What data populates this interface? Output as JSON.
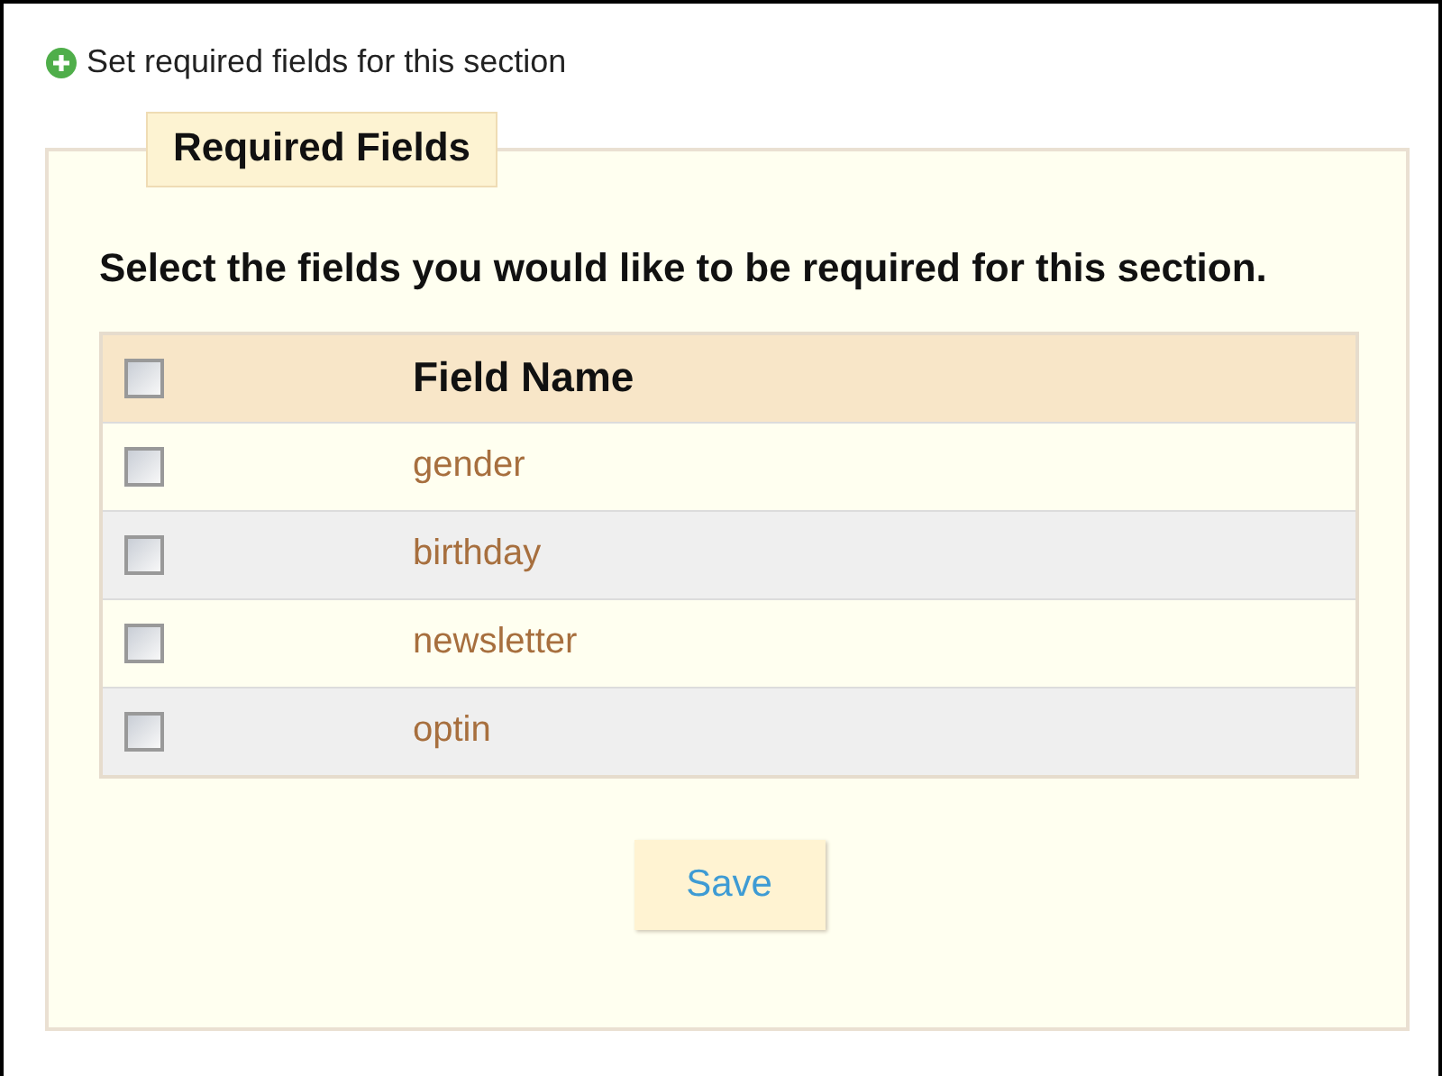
{
  "toggle_link": {
    "label": "Set required fields for this section"
  },
  "fieldset": {
    "legend": "Required Fields",
    "instructions": "Select the fields you would like to be required for this section.",
    "table": {
      "header": {
        "checked": false,
        "label": "Field Name"
      },
      "rows": [
        {
          "name": "gender",
          "checked": false
        },
        {
          "name": "birthday",
          "checked": false
        },
        {
          "name": "newsletter",
          "checked": false
        },
        {
          "name": "optin",
          "checked": false
        }
      ]
    },
    "save_button": "Save"
  }
}
